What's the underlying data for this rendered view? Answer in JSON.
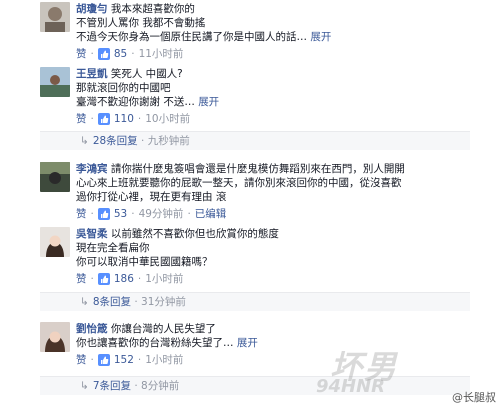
{
  "comments": [
    {
      "name": "胡瓊勻",
      "lines": [
        "我本來超喜歡你的",
        "不管別人罵你 我都不會動搖",
        "不過今天你身為一個原住民講了你是中國人的話…"
      ],
      "more": "展开",
      "like": "赞",
      "likes": "85",
      "time": "11小时前"
    },
    {
      "name": "王昱凱",
      "lines": [
        "笑死人 中國人?",
        "那就滾回你的中國吧",
        "臺灣不歡迎你謝謝 不送…"
      ],
      "more": "展开",
      "like": "赞",
      "likes": "110",
      "time": "10小时前",
      "replies": "28条回复",
      "replies_time": "九秒钟前"
    },
    {
      "name": "李鴻宾",
      "lines": [
        "請你揣什麼鬼簽唱會還是什麼鬼模仿舞蹈別來在西門，別人開開",
        "心心來上班就要聽你的屁歌一整天，請你別來滾回你的中國，從沒喜歡",
        "過你打從心裡，現在更有理由 滾"
      ],
      "like": "赞",
      "likes": "53",
      "time": "49分钟前",
      "edited": "已编辑"
    },
    {
      "name": "吳智柔",
      "lines": [
        "以前雖然不喜歡你但也欣賞你的態度",
        "現在完全看扁你",
        "你可以取消中華民國國籍嗎？"
      ],
      "like": "赞",
      "likes": "186",
      "time": "1小时前",
      "replies": "8条回复",
      "replies_time": "31分钟前"
    },
    {
      "name": "劉怡箴",
      "lines": [
        "你讓台灣的人民失望了",
        "你也讓喜歡你的台灣粉絲失望了…"
      ],
      "more": "展开",
      "like": "赞",
      "likes": "152",
      "time": "1小时前",
      "replies": "7条回复",
      "replies_time": "8分钟前"
    }
  ],
  "watermark_logo": "坏男",
  "watermark_site": "94HNR",
  "watermark_credit": "@长腿叔"
}
